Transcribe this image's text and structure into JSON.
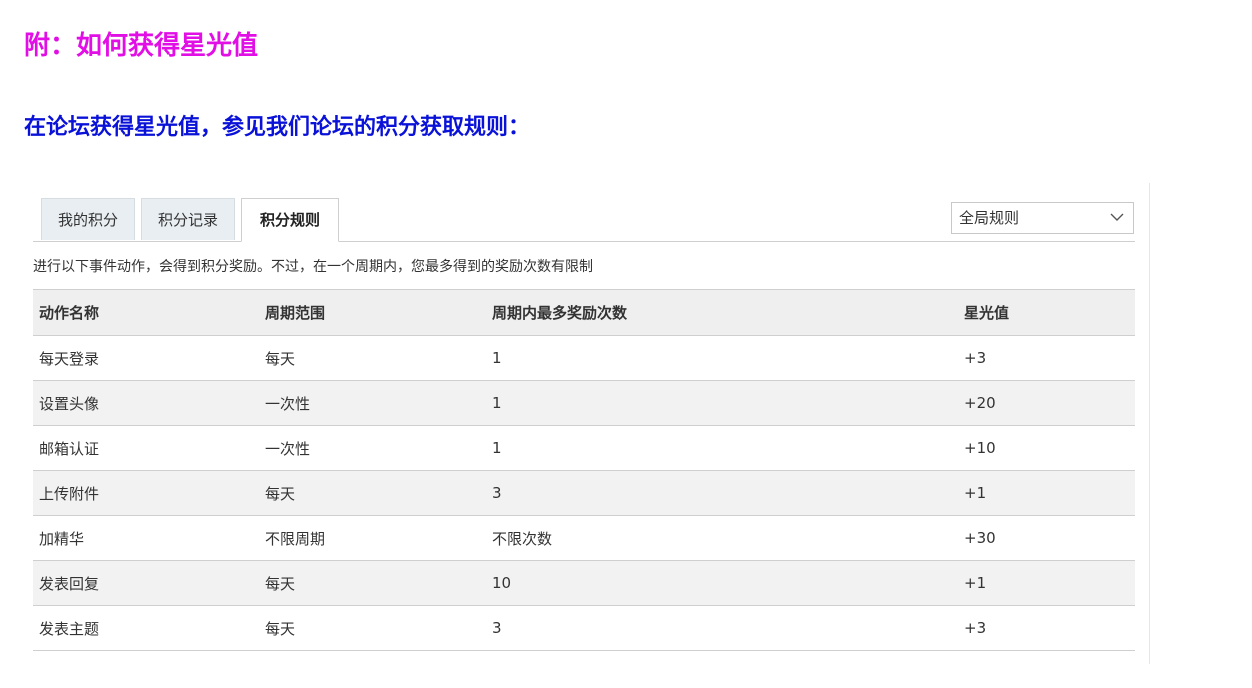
{
  "headings": {
    "appendix": "附：如何获得星光值",
    "intro": "在论坛获得星光值，参见我们论坛的积分获取规则："
  },
  "tabs": [
    {
      "label": "我的积分",
      "active": false
    },
    {
      "label": "积分记录",
      "active": false
    },
    {
      "label": "积分规则",
      "active": true
    }
  ],
  "rule_select": {
    "value": "全局规则",
    "icon": "chevron-down-icon"
  },
  "description": "进行以下事件动作，会得到积分奖励。不过，在一个周期内，您最多得到的奖励次数有限制",
  "table": {
    "headers": [
      "动作名称",
      "周期范围",
      "周期内最多奖励次数",
      "星光值"
    ],
    "rows": [
      [
        "每天登录",
        "每天",
        "1",
        "+3"
      ],
      [
        "设置头像",
        "一次性",
        "1",
        "+20"
      ],
      [
        "邮箱认证",
        "一次性",
        "1",
        "+10"
      ],
      [
        "上传附件",
        "每天",
        "3",
        "+1"
      ],
      [
        "加精华",
        "不限周期",
        "不限次数",
        "+30"
      ],
      [
        "发表回复",
        "每天",
        "10",
        "+1"
      ],
      [
        "发表主题",
        "每天",
        "3",
        "+3"
      ]
    ]
  },
  "colors": {
    "appendix_heading": "#e20ee6",
    "intro_heading": "#0a12d8"
  }
}
